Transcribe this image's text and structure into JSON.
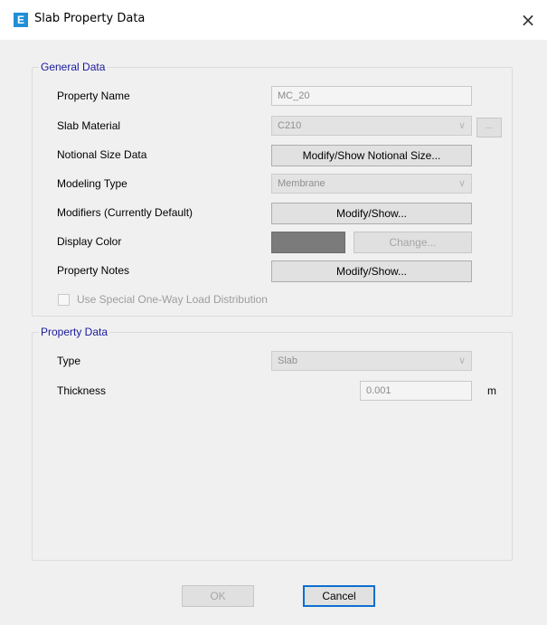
{
  "window": {
    "title": "Slab Property Data",
    "icon_letter": "E",
    "close_glyph": "×"
  },
  "general": {
    "legend": "General Data",
    "property_name_label": "Property Name",
    "property_name_value": "MC_20",
    "slab_material_label": "Slab Material",
    "slab_material_value": "C210",
    "material_browse_label": "...",
    "notional_label": "Notional Size Data",
    "notional_button": "Modify/Show Notional Size...",
    "modeling_type_label": "Modeling Type",
    "modeling_type_value": "Membrane",
    "modifiers_label": "Modifiers (Currently Default)",
    "modifiers_button": "Modify/Show...",
    "display_color_label": "Display Color",
    "display_color_value": "#7b7b7b",
    "change_button": "Change...",
    "notes_label": "Property Notes",
    "notes_button": "Modify/Show...",
    "oneway_label": "Use Special One-Way Load Distribution"
  },
  "property": {
    "legend": "Property Data",
    "type_label": "Type",
    "type_value": "Slab",
    "thickness_label": "Thickness",
    "thickness_value": "0.001",
    "thickness_unit": "m"
  },
  "footer": {
    "ok_label": "OK",
    "cancel_label": "Cancel"
  },
  "icons": {
    "chevron": "∨"
  }
}
